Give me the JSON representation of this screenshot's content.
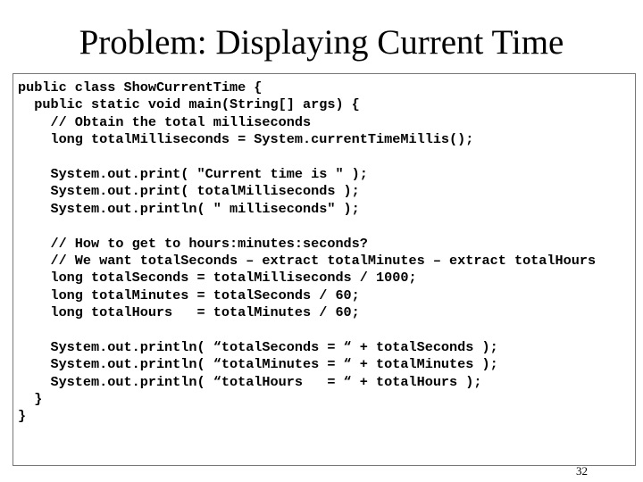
{
  "slide": {
    "title": "Problem: Displaying Current Time",
    "page_number": "32"
  },
  "code": {
    "lines": [
      "public class ShowCurrentTime {",
      "  public static void main(String[] args) {",
      "    // Obtain the total milliseconds",
      "    long totalMilliseconds = System.currentTimeMillis();",
      "",
      "    System.out.print( \"Current time is \" );",
      "    System.out.print( totalMilliseconds );",
      "    System.out.println( \" milliseconds\" );",
      "",
      "    // How to get to hours:minutes:seconds?",
      "    // We want totalSeconds – extract totalMinutes – extract totalHours",
      "    long totalSeconds = totalMilliseconds / 1000;",
      "    long totalMinutes = totalSeconds / 60;",
      "    long totalHours   = totalMinutes / 60;",
      "",
      "    System.out.println( “totalSeconds = “ + totalSeconds );",
      "    System.out.println( “totalMinutes = “ + totalMinutes );",
      "    System.out.println( “totalHours   = “ + totalHours );",
      "  }",
      "}"
    ]
  }
}
